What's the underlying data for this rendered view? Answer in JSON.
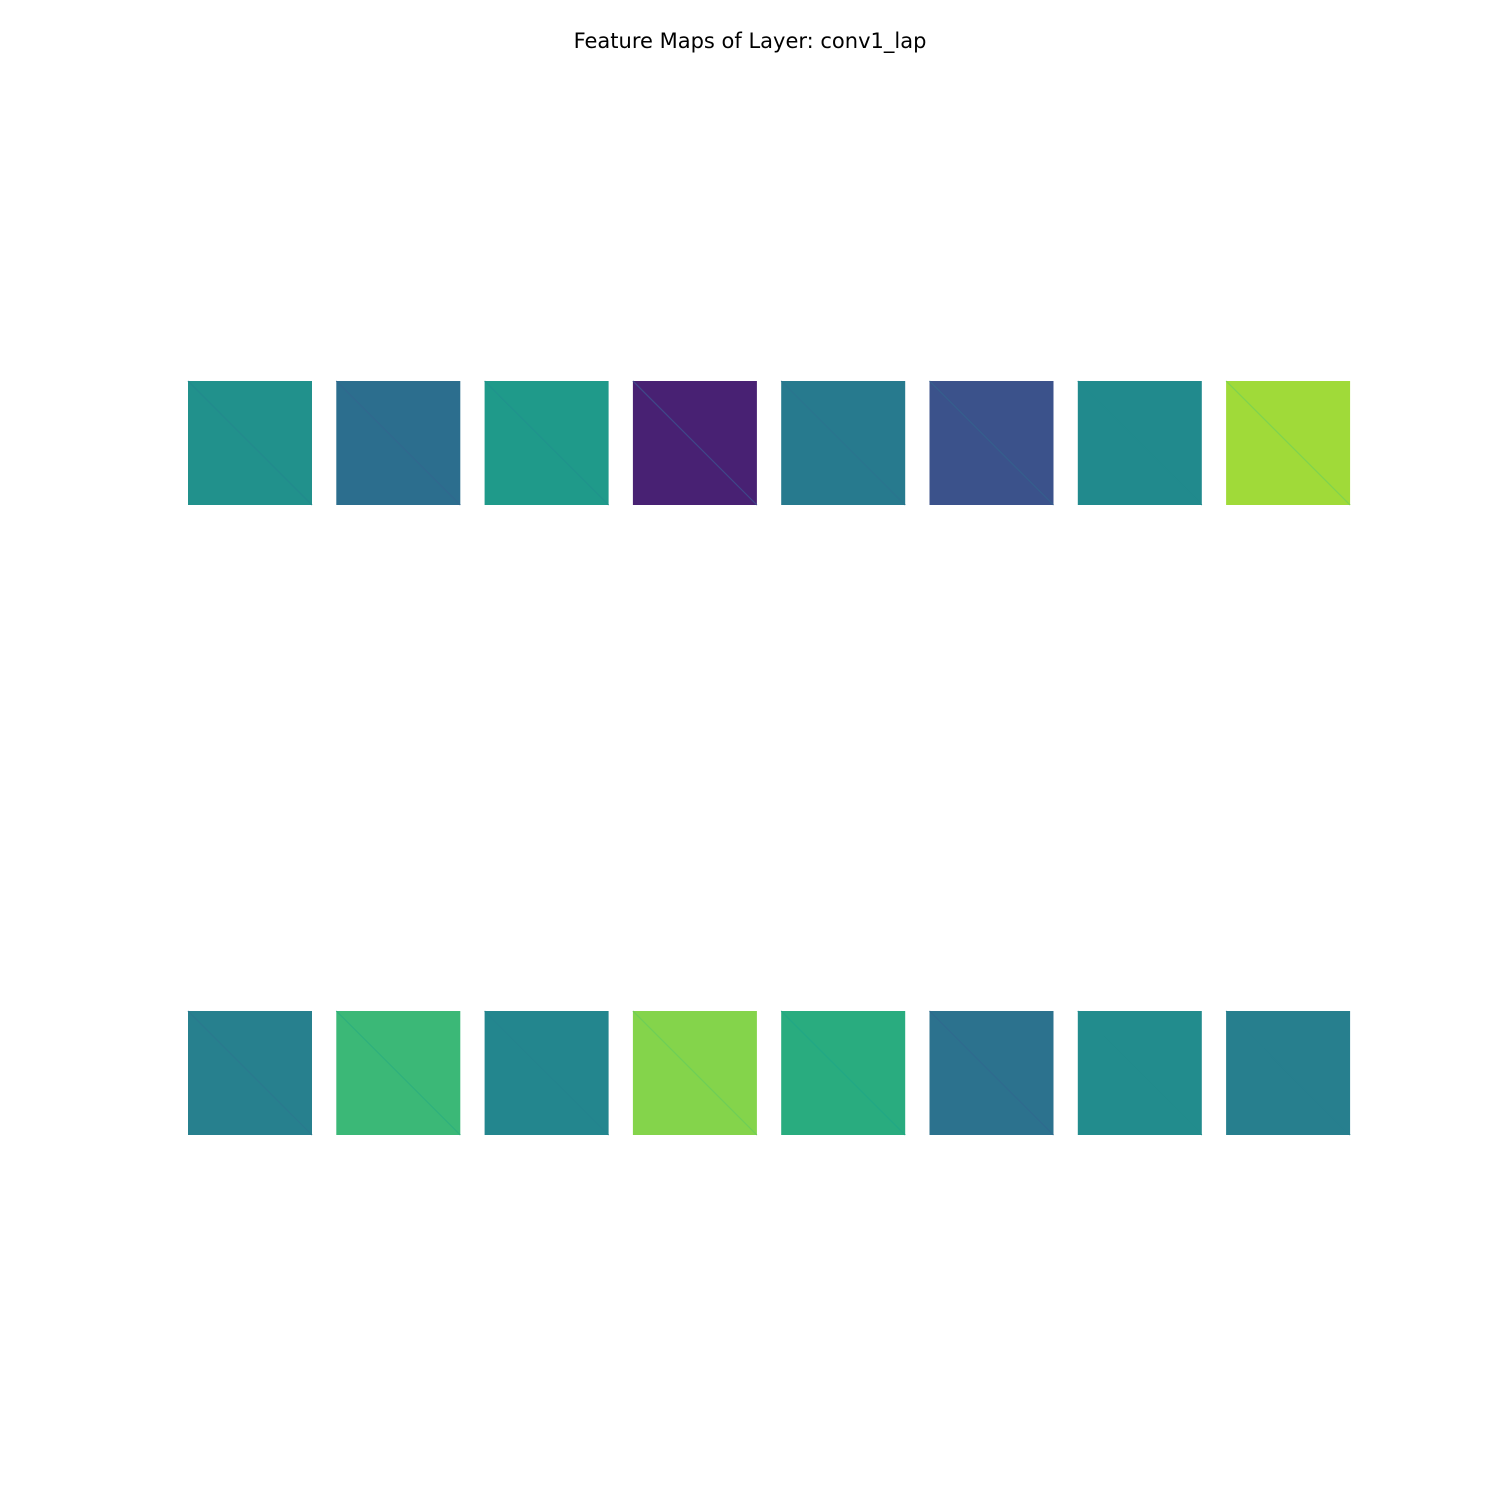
{
  "chart_data": {
    "type": "heatmap",
    "title": "Feature Maps of Layer: conv1_lap",
    "rows": 2,
    "cols": 8,
    "colormap": "viridis",
    "axes": "off",
    "diagonal": "top-left to bottom-right",
    "maps": [
      {
        "base": "#21918c",
        "diag": "#238a8d"
      },
      {
        "base": "#2c6e8e",
        "diag": "#31688e"
      },
      {
        "base": "#1f9a8a",
        "diag": "#20938c"
      },
      {
        "base": "#482173",
        "diag": "#3f4889"
      },
      {
        "base": "#277a8e",
        "diag": "#2a758e"
      },
      {
        "base": "#3b528b",
        "diag": "#355f8d"
      },
      {
        "base": "#218a8d",
        "diag": "#218a8d"
      },
      {
        "base": "#a0da39",
        "diag": "#7ed34f"
      },
      {
        "base": "#27808e",
        "diag": "#2a798e"
      },
      {
        "base": "#3bb877",
        "diag": "#2eaf7d"
      },
      {
        "base": "#23868e",
        "diag": "#24848e"
      },
      {
        "base": "#84d44b",
        "diag": "#6ece58"
      },
      {
        "base": "#29ac7f",
        "diag": "#22a884"
      },
      {
        "base": "#2c728e",
        "diag": "#2f6b8e"
      },
      {
        "base": "#228c8d",
        "diag": "#228c8d"
      },
      {
        "base": "#277f8e",
        "diag": "#277f8e"
      }
    ]
  }
}
